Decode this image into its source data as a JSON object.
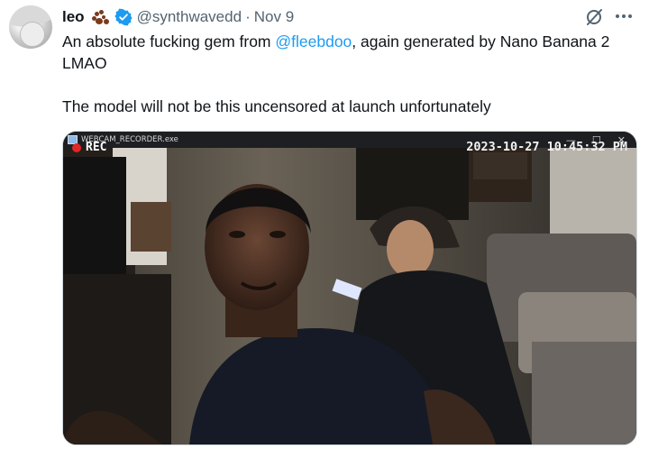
{
  "author": {
    "name": "leo",
    "handle": "@synthwavedd",
    "separator": "·",
    "date": "Nov 9",
    "verified": true,
    "badge_icon": "paw-prints-emoji"
  },
  "tweet": {
    "line1_prefix": "An absolute fucking gem from ",
    "mention": "@fleebdoo",
    "line1_suffix": ", again generated by Nano Banana 2 LMAO",
    "line2": "The model will not be this uncensored at launch unfortunately"
  },
  "actions": {
    "grok_icon": "grok-icon",
    "more_icon": "more-dots-icon"
  },
  "media": {
    "window_title": "WEBCAM_RECORDER.exe",
    "window_controls": [
      "—",
      "☐",
      "✕"
    ],
    "rec_label": "REC",
    "timestamp": "2023-10-27 10:45:32 PM"
  },
  "colors": {
    "accent": "#1d9bf0",
    "text": "#0f1419",
    "muted": "#536471",
    "rec_dot": "#e02626"
  }
}
